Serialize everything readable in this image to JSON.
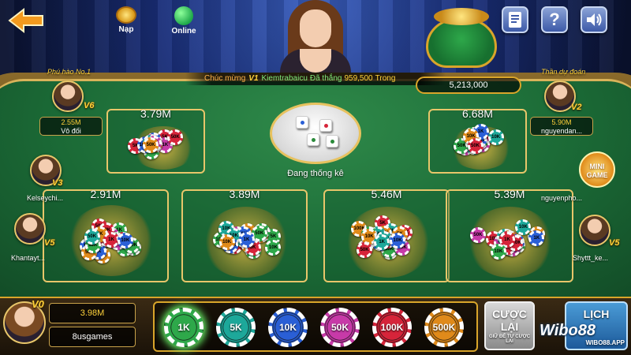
{
  "header": {
    "nap_label": "Nạp",
    "online_label": "Online"
  },
  "ticker": {
    "prefix": "Chúc mừng",
    "vip": "V1",
    "name": "Kiemtrabaicu",
    "message": "Đã thắng",
    "amount": "959,500",
    "suffix": "Trong"
  },
  "pot": {
    "value": "5,213,000"
  },
  "table": {
    "status": "Đang thống kê",
    "bets": [
      {
        "label": "3.79M"
      },
      {
        "label": "6.68M"
      },
      {
        "label": "2.91M"
      },
      {
        "label": "3.89M"
      },
      {
        "label": "5.46M"
      },
      {
        "label": "5.39M"
      }
    ]
  },
  "players": {
    "rich": {
      "title": "Phú hào No.1",
      "vip": "V6",
      "money": "2.55M",
      "name": "Vô đối"
    },
    "prophet": {
      "title": "Thần dự đoán",
      "vip": "V2",
      "money": "5.90M",
      "name": "nguyendan..."
    },
    "p_left1": {
      "vip": "V3",
      "name": "Kelseychi..."
    },
    "p_left2": {
      "vip": "V5",
      "name": "Khantayt..."
    },
    "p_right1": {
      "name": "nguyenpho..."
    },
    "p_right2": {
      "vip": "V5",
      "name": "Shyttt_ke..."
    }
  },
  "mini_game": {
    "label_line1": "MINI",
    "label_line2": "GAME"
  },
  "self": {
    "vip": "V0",
    "money": "3.98M",
    "name": "8usgames"
  },
  "chips": [
    {
      "label": "1K",
      "color": "#2ea84a",
      "selected": true
    },
    {
      "label": "5K",
      "color": "#1da89a",
      "selected": false
    },
    {
      "label": "10K",
      "color": "#2a5fd6",
      "selected": false
    },
    {
      "label": "50K",
      "color": "#c73aa8",
      "selected": false
    },
    {
      "label": "100K",
      "color": "#d6243a",
      "selected": false
    },
    {
      "label": "500K",
      "color": "#e08a1a",
      "selected": false
    }
  ],
  "actions": {
    "rebet_line1": "CƯỢC",
    "rebet_line2": "LẠI",
    "rebet_sub": "GIỮ ĐỂ TỰ CƯỢC LẠI",
    "history_label": "LỊCH"
  },
  "watermark": {
    "main": "Wibo88",
    "sub": "WIBO88.APP"
  }
}
